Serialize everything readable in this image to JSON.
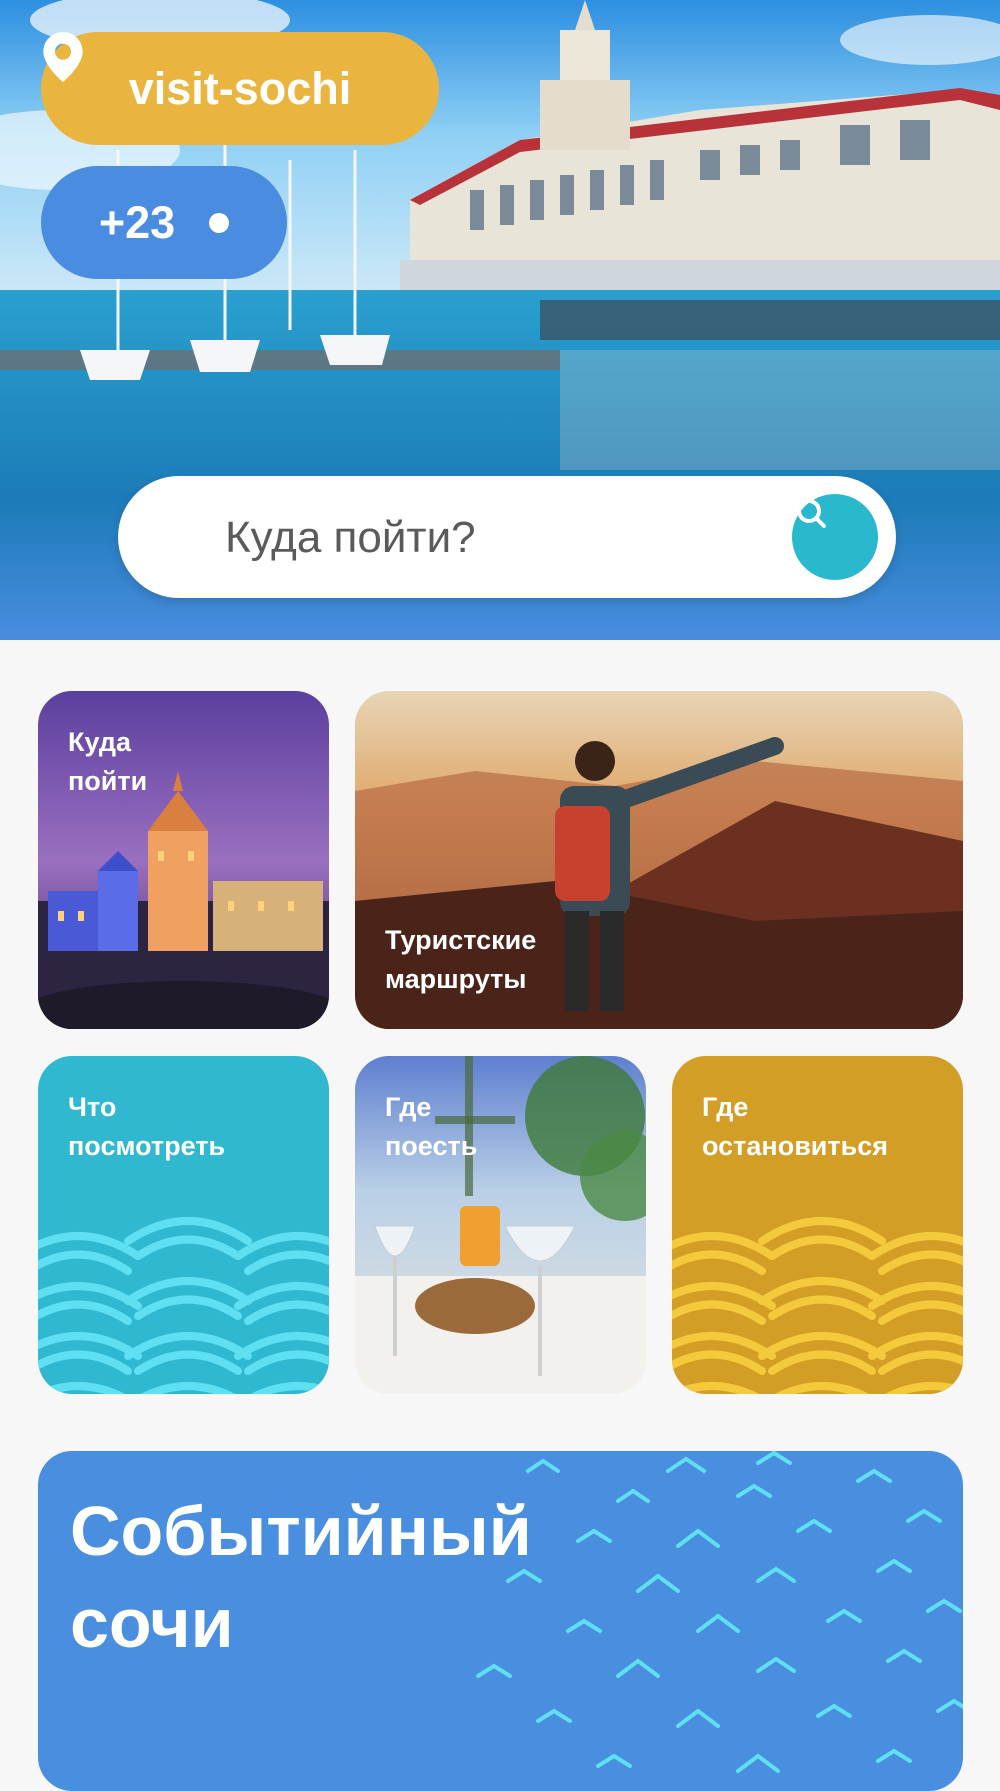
{
  "header": {
    "location_label": "visit-sochi",
    "weather_temp": "+23"
  },
  "search": {
    "placeholder": "Куда пойти?"
  },
  "tiles": [
    {
      "label": "Куда\nпойти"
    },
    {
      "label": "Туристские\nмаршруты"
    },
    {
      "label": "Что\nпосмотреть"
    },
    {
      "label": "Где\nпоесть"
    },
    {
      "label": "Где\nостановиться"
    }
  ],
  "events": {
    "title": "Событийный\nсочи"
  },
  "icons": {
    "location": "location-pin-icon",
    "weather": "sun-icon",
    "search": "search-icon"
  },
  "colors": {
    "yellow": "#e9b53f",
    "blue": "#4a8ce0",
    "teal": "#2fb8cf",
    "gold": "#d39e25",
    "events_blue": "#4a8ee0",
    "search_button": "#2ab8cf"
  }
}
